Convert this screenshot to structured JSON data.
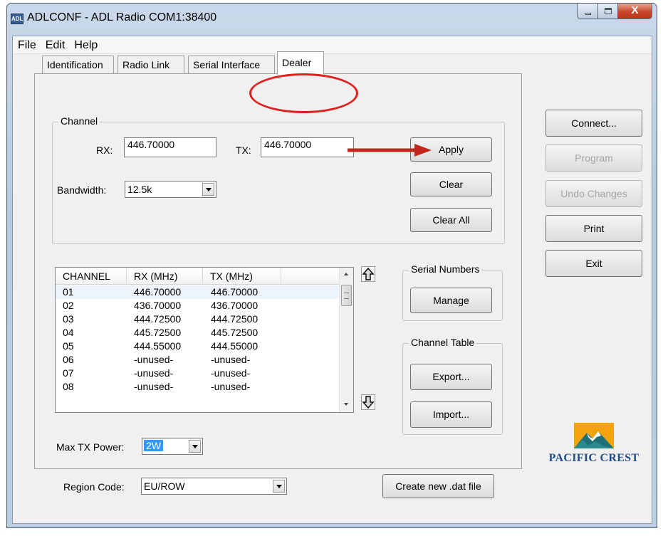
{
  "window": {
    "title": "ADLCONF - ADL Radio COM1:38400",
    "icon_text": "ADL",
    "close_glyph": "X"
  },
  "menu": {
    "items": [
      "File",
      "Edit",
      "Help"
    ]
  },
  "tabs": [
    {
      "label": "Identification",
      "active": false
    },
    {
      "label": "Radio Link",
      "active": false
    },
    {
      "label": "Serial Interface",
      "active": false
    },
    {
      "label": "Dealer",
      "active": true
    }
  ],
  "channel_group": {
    "title": "Channel",
    "rx_label": "RX:",
    "rx_value": "446.70000",
    "tx_label": "TX:",
    "tx_value": "446.70000",
    "bandwidth_label": "Bandwidth:",
    "bandwidth_value": "12.5k",
    "apply_label": "Apply",
    "clear_label": "Clear",
    "clear_all_label": "Clear All"
  },
  "channel_list": {
    "columns": [
      "CHANNEL",
      "RX (MHz)",
      "TX (MHz)"
    ],
    "rows": [
      [
        "01",
        "446.70000",
        "446.70000"
      ],
      [
        "02",
        "436.70000",
        "436.70000"
      ],
      [
        "03",
        "444.72500",
        "444.72500"
      ],
      [
        "04",
        "445.72500",
        "445.72500"
      ],
      [
        "05",
        "444.55000",
        "444.55000"
      ],
      [
        "06",
        "-unused-",
        "-unused-"
      ],
      [
        "07",
        "-unused-",
        "-unused-"
      ],
      [
        "08",
        "-unused-",
        "-unused-"
      ]
    ]
  },
  "serial_numbers": {
    "title": "Serial Numbers",
    "manage_label": "Manage"
  },
  "channel_table": {
    "title": "Channel Table",
    "export_label": "Export...",
    "import_label": "Import..."
  },
  "max_tx_power": {
    "label": "Max TX Power:",
    "value": "2W"
  },
  "region_code": {
    "label": "Region Code:",
    "value": "EU/ROW"
  },
  "create_dat_label": "Create new .dat file",
  "side_buttons": {
    "connect": "Connect...",
    "program": "Program",
    "undo": "Undo Changes",
    "print": "Print",
    "exit": "Exit"
  },
  "logo": {
    "text": "PACIFIC CREST"
  },
  "colors": {
    "annotation_red": "#e02020",
    "selection_blue": "#3399ff",
    "logo_blue": "#1f4e88",
    "logo_orange": "#f2a30f"
  },
  "icons": {
    "move_up": "up-arrow-icon",
    "move_down": "down-arrow-icon",
    "combo_dropdown": "chevron-down-icon"
  }
}
